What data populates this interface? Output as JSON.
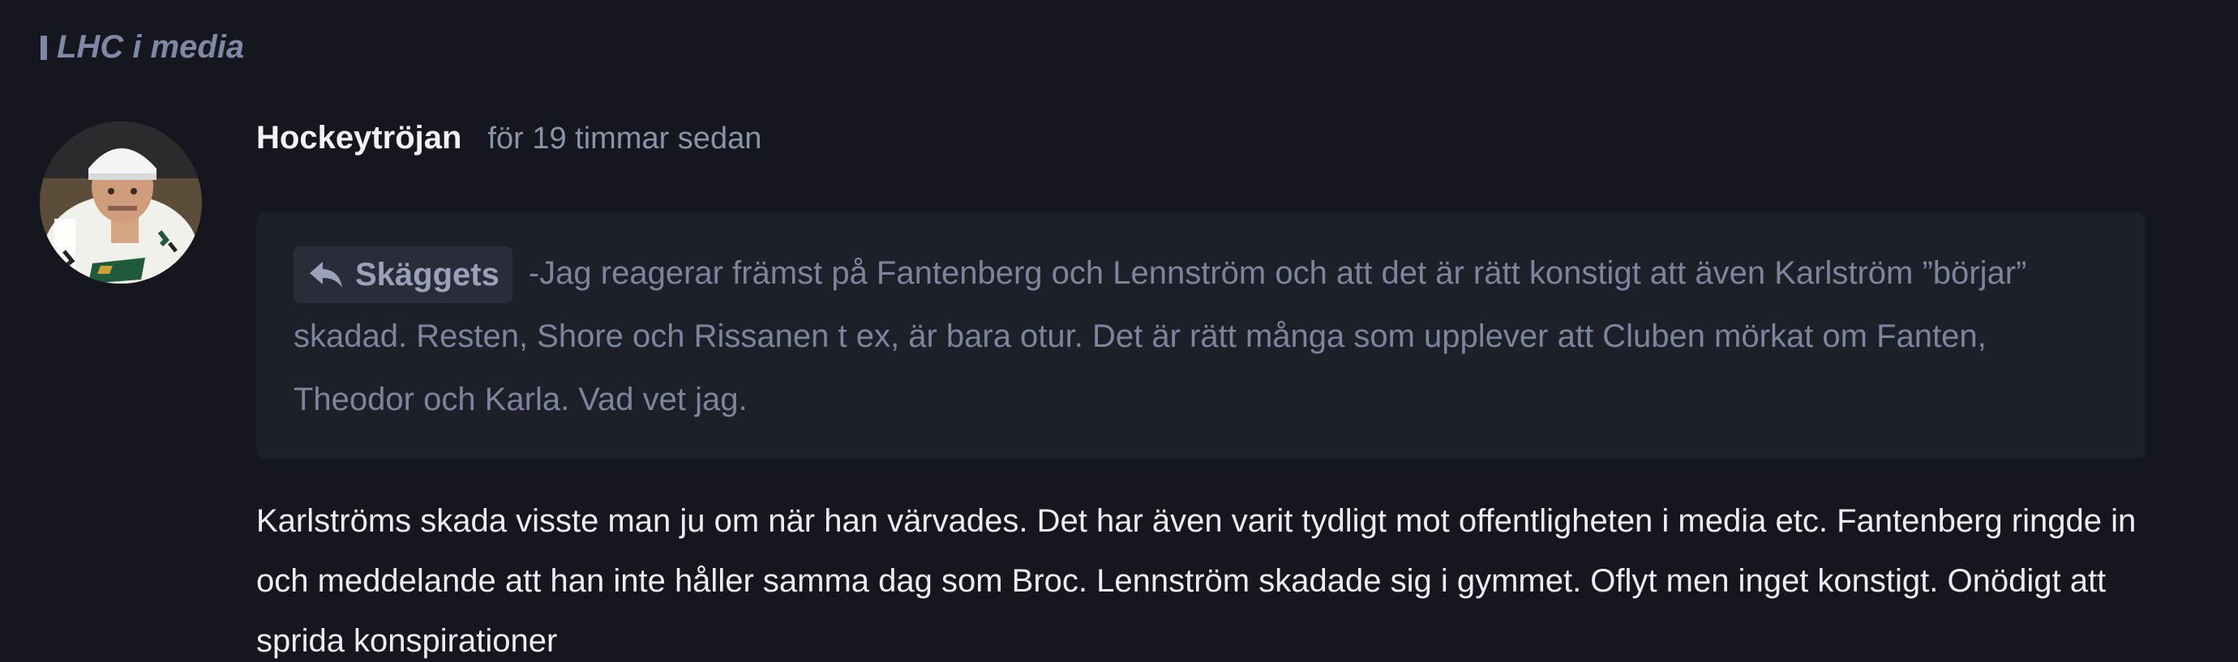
{
  "topic": {
    "label": "LHC i media"
  },
  "post": {
    "author": "Hockeytröjan",
    "timestamp": "för 19 timmar sedan",
    "avatar_icon": "hockey-player-avatar",
    "quote": {
      "source_label": "Skäggets",
      "icon": "reply-arrow-icon",
      "text": "-Jag reagerar främst på Fantenberg och Lennström och att det är rätt konstigt att även Karlström ”börjar” skadad. Resten, Shore och Rissanen t ex, är bara otur. Det är rätt många som upplever att Cluben mörkat om Fanten, Theodor och Karla. Vad vet jag."
    },
    "body": "Karlströms skada visste man ju om när han värvades. Det har även varit tydligt mot offentligheten i media etc. Fantenberg ringde in och meddelande att han inte håller samma dag som Broc. Lennström skadade sig i gymmet. Oflyt men inget konstigt. Onödigt att sprida konspirationer"
  },
  "colors": {
    "background": "#16171e",
    "quote_background": "#1d1f29",
    "muted_text": "#7d859d",
    "body_text": "#eceef3"
  }
}
